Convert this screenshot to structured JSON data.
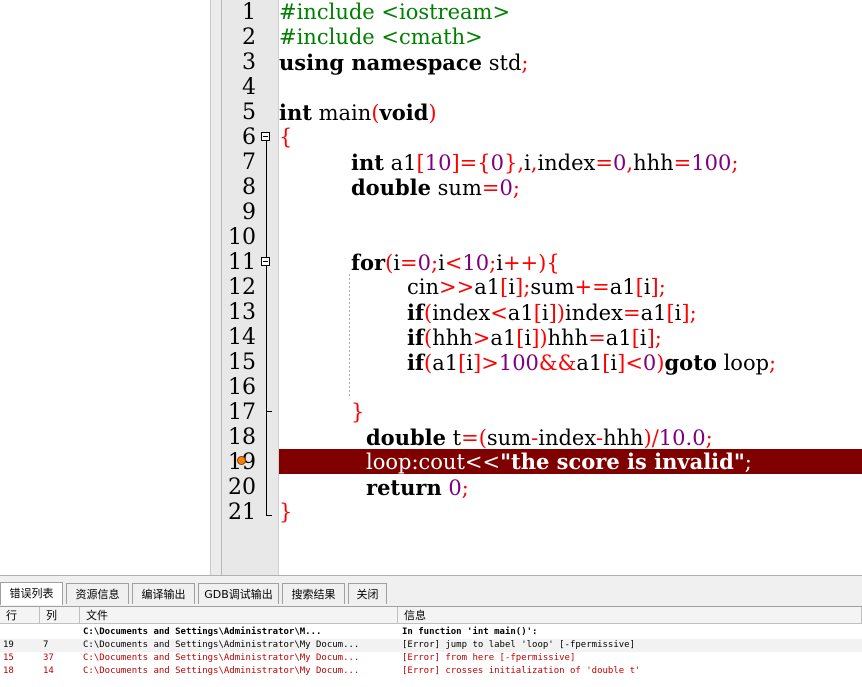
{
  "colors": {
    "keyword": "#000000",
    "preprocessor": "#008000",
    "symbol": "#ff0000",
    "number": "#800080",
    "error_line_bg": "#800000",
    "error_text": "#c00000"
  },
  "editor": {
    "line_numbers": [
      "1",
      "2",
      "3",
      "4",
      "5",
      "6",
      "7",
      "8",
      "9",
      "10",
      "11",
      "12",
      "13",
      "14",
      "15",
      "16",
      "17",
      "18",
      "19",
      "20",
      "21"
    ],
    "lines": {
      "l1": "#include <iostream>",
      "l2": "#include <cmath>",
      "l3_kw": "using namespace",
      "l3_rest": " std",
      "l3_sym": ";",
      "l5_kw": "int",
      "l5_name": " main",
      "l5_p1": "(",
      "l5_void": "void",
      "l5_p2": ")",
      "l6": "{",
      "l7_kw": "int",
      "l7_a": " a1",
      "l7_b": "[",
      "l7_c": "10",
      "l7_d": "]={",
      "l7_e": "0",
      "l7_f": "},",
      "l7_g": "i",
      "l7_h": ",",
      "l7_i": "index",
      "l7_j": "=",
      "l7_k": "0",
      "l7_l": ",",
      "l7_m": "hhh",
      "l7_n": "=",
      "l7_o": "100",
      "l7_p": ";",
      "l8_kw": "double",
      "l8_a": " sum",
      "l8_b": "=",
      "l8_c": "0",
      "l8_d": ";",
      "l11_kw": "for",
      "l11_a": "(",
      "l11_b": "i",
      "l11_c": "=",
      "l11_d": "0",
      "l11_e": ";",
      "l11_f": "i",
      "l11_g": "<",
      "l11_h": "10",
      "l11_i": ";",
      "l11_j": "i",
      "l11_k": "++){",
      "l12_a": "cin",
      "l12_b": ">>",
      "l12_c": "a1",
      "l12_d": "[",
      "l12_e": "i",
      "l12_f": "];",
      "l12_g": "sum",
      "l12_h": "+=",
      "l12_i": "a1",
      "l12_j": "[",
      "l12_k": "i",
      "l12_l": "];",
      "l13_kw": "if",
      "l13_a": "(",
      "l13_b": "index",
      "l13_c": "<",
      "l13_d": "a1",
      "l13_e": "[",
      "l13_f": "i",
      "l13_g": "])",
      "l13_h": "index",
      "l13_i": "=",
      "l13_j": "a1",
      "l13_k": "[",
      "l13_l": "i",
      "l13_m": "];",
      "l14_kw": "if",
      "l14_a": "(",
      "l14_b": "hhh",
      "l14_c": ">",
      "l14_d": "a1",
      "l14_e": "[",
      "l14_f": "i",
      "l14_g": "])",
      "l14_h": "hhh",
      "l14_i": "=",
      "l14_j": "a1",
      "l14_k": "[",
      "l14_l": "i",
      "l14_m": "];",
      "l15_kw": "if",
      "l15_a": "(",
      "l15_b": "a1",
      "l15_c": "[",
      "l15_d": "i",
      "l15_e": "]>",
      "l15_f": "100",
      "l15_g": "&&",
      "l15_h": "a1",
      "l15_i": "[",
      "l15_j": "i",
      "l15_k": "]<",
      "l15_l": "0",
      "l15_m": ")",
      "l15_kw2": "goto",
      "l15_n": " loop",
      "l15_o": ";",
      "l17": "}",
      "l18_kw": "double",
      "l18_a": " t",
      "l18_b": "=(",
      "l18_c": "sum",
      "l18_d": "-",
      "l18_e": "index",
      "l18_f": "-",
      "l18_g": "hhh",
      "l18_h": ")/",
      "l18_i": "10.0",
      "l18_j": ";",
      "l19_a": "loop:cout<<",
      "l19_str": "\"the score is invalid\"",
      "l19_b": ";",
      "l20_kw": "return",
      "l20_a": " ",
      "l20_b": "0",
      "l20_c": ";",
      "l21": "}"
    }
  },
  "bottom_tabs": [
    "错误列表",
    "资源信息",
    "编译输出",
    "GDB调试输出",
    "搜索结果",
    "关闭"
  ],
  "messages": {
    "headers": [
      "行",
      "列",
      "文件",
      "信息"
    ],
    "rows": [
      {
        "line": "",
        "col": "",
        "file": "C:\\Documents and Settings\\Administrator\\M...",
        "info": "In function 'int main()':"
      },
      {
        "line": "19",
        "col": "7",
        "file": "C:\\Documents and Settings\\Administrator\\My Docum...",
        "info": "[Error] jump to label 'loop' [-fpermissive]"
      },
      {
        "line": "15",
        "col": "37",
        "file": "C:\\Documents and Settings\\Administrator\\My Docum...",
        "info": "[Error] from here [-fpermissive]"
      },
      {
        "line": "18",
        "col": "14",
        "file": "C:\\Documents and Settings\\Administrator\\My Docum...",
        "info": "[Error] crosses initialization of 'double t'"
      }
    ]
  }
}
